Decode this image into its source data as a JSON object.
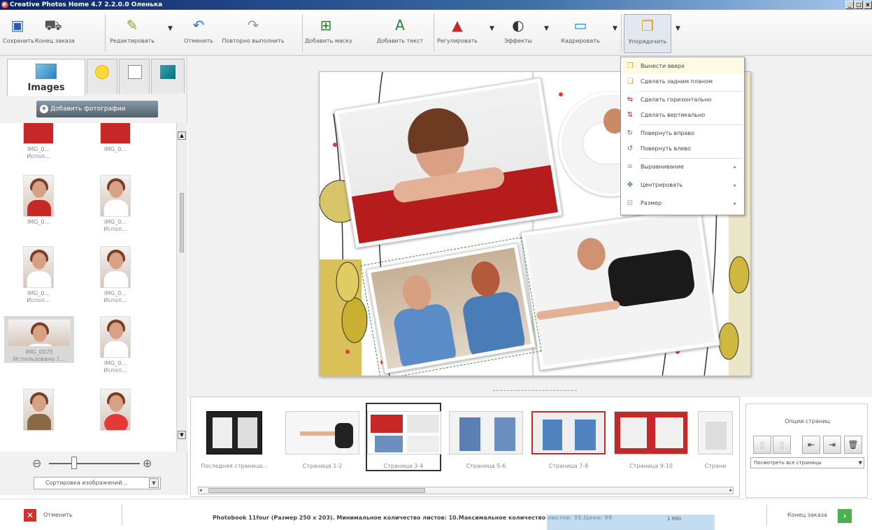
{
  "window": {
    "title": "Creative Photos Home 4.7 2.2.0.0 Оленька"
  },
  "toolbar": {
    "save": "Сохранить",
    "cart": "Конец заказа",
    "edit": "Редактировать",
    "undo": "Отменить",
    "redo": "Повторно выполнить",
    "add_frame": "Добавить маску",
    "add_text": "Добавить текст",
    "adjust": "Регулировать",
    "effects": "Эффекты",
    "crop": "Кадрировать",
    "arrange": "Упорядочить"
  },
  "left_panel": {
    "tab_images": "Images",
    "add_photos": "Добавить фотографии",
    "thumbnails": [
      {
        "name": "IMG_0...",
        "status": "Испол..."
      },
      {
        "name": "IMG_0...",
        "status": ""
      },
      {
        "name": "IMG_0...",
        "status": ""
      },
      {
        "name": "IMG_0...",
        "status": "Испол..."
      },
      {
        "name": "IMG_0...",
        "status": "Испол..."
      },
      {
        "name": "IMG_0...",
        "status": "Испол..."
      },
      {
        "name": "IMG_0075",
        "status": "Использовано 1..."
      },
      {
        "name": "IMG_0...",
        "status": "Испол..."
      },
      {
        "name": "",
        "status": ""
      },
      {
        "name": "",
        "status": ""
      }
    ],
    "sort": "Сортировка изображений..."
  },
  "context_menu": {
    "items": [
      {
        "label": "Вынести вверх",
        "icon": "bring-forward-icon",
        "submenu": false
      },
      {
        "label": "Сделать задним планом",
        "icon": "send-back-icon",
        "submenu": false
      },
      {
        "label": "Сделать горизонтально",
        "icon": "flip-horizontal-icon",
        "submenu": false
      },
      {
        "label": "Сделать вертикально",
        "icon": "flip-vertical-icon",
        "submenu": false
      },
      {
        "label": "Повернуть вправо",
        "icon": "rotate-right-icon",
        "submenu": false
      },
      {
        "label": "Повернуть влево",
        "icon": "rotate-left-icon",
        "submenu": false
      },
      {
        "label": "Выравнивание",
        "icon": "align-icon",
        "submenu": true
      },
      {
        "label": "Центрировать",
        "icon": "center-icon",
        "submenu": true
      },
      {
        "label": "Размер",
        "icon": "size-icon",
        "submenu": true
      }
    ]
  },
  "pages": [
    {
      "label": "Последняя страница..."
    },
    {
      "label": "Страница 1-2"
    },
    {
      "label": "Страница 3-4"
    },
    {
      "label": "Страница 5-6"
    },
    {
      "label": "Страница 7-8"
    },
    {
      "label": "Страница 9-10"
    },
    {
      "label": "Страни"
    }
  ],
  "page_options": {
    "title": "Опции страниц",
    "view": "Посмотреть все страницы"
  },
  "bottom": {
    "cancel": "Отменить",
    "status": "Photobook 11four (Размер 250 x 203). Минимальное количество листов: 10.Максимальное количество листов: 35.Цена: 99",
    "tooltip": "1 990",
    "checkout": "Конец заказа"
  },
  "colors": {
    "accent_red": "#c62828",
    "checkout_green": "#4caf50",
    "cancel_red": "#d32f2f"
  }
}
